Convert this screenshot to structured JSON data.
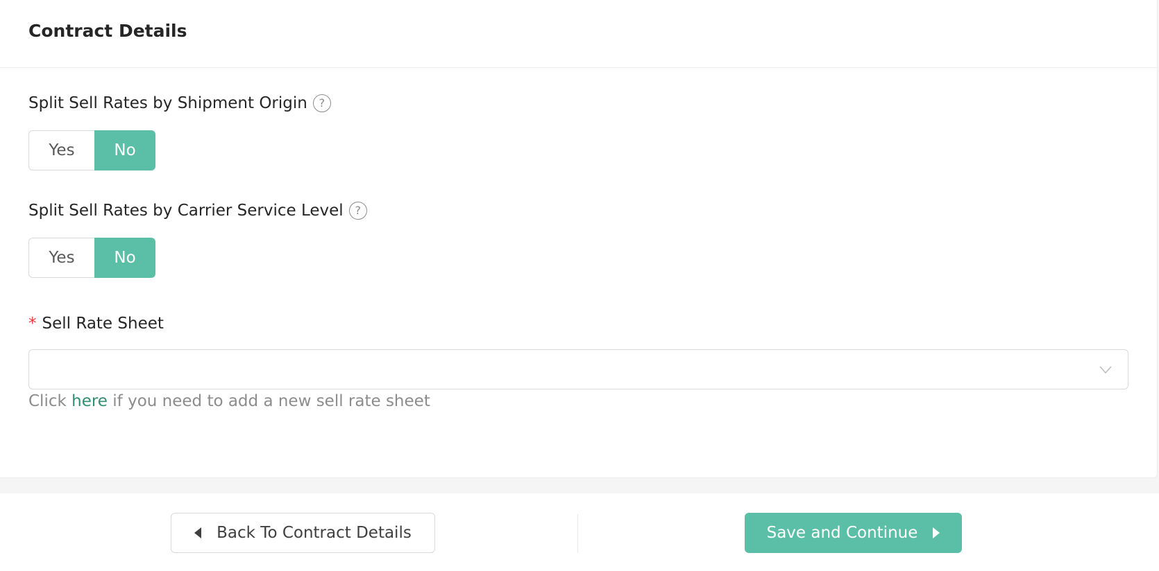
{
  "card": {
    "title": "Contract Details"
  },
  "fields": {
    "split_origin": {
      "label": "Split Sell Rates by Shipment Origin",
      "help_icon": "?",
      "options": {
        "yes": "Yes",
        "no": "No"
      },
      "selected": "No"
    },
    "split_service_level": {
      "label": "Split Sell Rates by Carrier Service Level",
      "help_icon": "?",
      "options": {
        "yes": "Yes",
        "no": "No"
      },
      "selected": "No"
    },
    "sell_rate_sheet": {
      "required_mark": "*",
      "label": "Sell Rate Sheet",
      "value": "",
      "helper_prefix": "Click ",
      "helper_link": "here",
      "helper_suffix": " if you need to add a new sell rate sheet"
    }
  },
  "footer": {
    "back_label": "Back To Contract Details",
    "save_label": "Save and Continue"
  },
  "colors": {
    "accent": "#5bbfa7",
    "link": "#2f8f73",
    "required": "#e53935"
  }
}
